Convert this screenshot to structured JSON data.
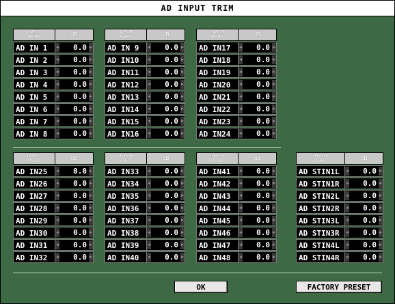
{
  "window": {
    "title": "AD INPUT TRIM"
  },
  "columns": {
    "port": "INPUT\nPORT",
    "db": "dB"
  },
  "groups": [
    {
      "id": "in-1-8",
      "rows": [
        [
          "AD IN 1",
          "0.0"
        ],
        [
          "AD IN 2",
          "0.0"
        ],
        [
          "AD IN 3",
          "0.0"
        ],
        [
          "AD IN 4",
          "0.0"
        ],
        [
          "AD IN 5",
          "0.0"
        ],
        [
          "AD IN 6",
          "0.0"
        ],
        [
          "AD IN 7",
          "0.0"
        ],
        [
          "AD IN 8",
          "0.0"
        ]
      ]
    },
    {
      "id": "in-9-16",
      "rows": [
        [
          "AD IN 9",
          "0.0"
        ],
        [
          "AD IN10",
          "0.0"
        ],
        [
          "AD IN11",
          "0.0"
        ],
        [
          "AD IN12",
          "0.0"
        ],
        [
          "AD IN13",
          "0.0"
        ],
        [
          "AD IN14",
          "0.0"
        ],
        [
          "AD IN15",
          "0.0"
        ],
        [
          "AD IN16",
          "0.0"
        ]
      ]
    },
    {
      "id": "in-17-24",
      "rows": [
        [
          "AD IN17",
          "0.0"
        ],
        [
          "AD IN18",
          "0.0"
        ],
        [
          "AD IN19",
          "0.0"
        ],
        [
          "AD IN20",
          "0.0"
        ],
        [
          "AD IN21",
          "0.0"
        ],
        [
          "AD IN22",
          "0.0"
        ],
        [
          "AD IN23",
          "0.0"
        ],
        [
          "AD IN24",
          "0.0"
        ]
      ]
    },
    {
      "id": "in-25-32",
      "rows": [
        [
          "AD IN25",
          "0.0"
        ],
        [
          "AD IN26",
          "0.0"
        ],
        [
          "AD IN27",
          "0.0"
        ],
        [
          "AD IN28",
          "0.0"
        ],
        [
          "AD IN29",
          "0.0"
        ],
        [
          "AD IN30",
          "0.0"
        ],
        [
          "AD IN31",
          "0.0"
        ],
        [
          "AD IN32",
          "0.0"
        ]
      ]
    },
    {
      "id": "in-33-40",
      "rows": [
        [
          "AD IN33",
          "0.0"
        ],
        [
          "AD IN34",
          "0.0"
        ],
        [
          "AD IN35",
          "0.0"
        ],
        [
          "AD IN36",
          "0.0"
        ],
        [
          "AD IN37",
          "0.0"
        ],
        [
          "AD IN38",
          "0.0"
        ],
        [
          "AD IN39",
          "0.0"
        ],
        [
          "AD IN40",
          "0.0"
        ]
      ]
    },
    {
      "id": "in-41-48",
      "rows": [
        [
          "AD IN41",
          "0.0"
        ],
        [
          "AD IN42",
          "0.0"
        ],
        [
          "AD IN43",
          "0.0"
        ],
        [
          "AD IN44",
          "0.0"
        ],
        [
          "AD IN45",
          "0.0"
        ],
        [
          "AD IN46",
          "0.0"
        ],
        [
          "AD IN47",
          "0.0"
        ],
        [
          "AD IN48",
          "0.0"
        ]
      ]
    },
    {
      "id": "stin",
      "rows": [
        [
          "AD STIN1L",
          "0.0"
        ],
        [
          "AD STIN1R",
          "0.0"
        ],
        [
          "AD STIN2L",
          "0.0"
        ],
        [
          "AD STIN2R",
          "0.0"
        ],
        [
          "AD STIN3L",
          "0.0"
        ],
        [
          "AD STIN3R",
          "0.0"
        ],
        [
          "AD STIN4L",
          "0.0"
        ],
        [
          "AD STIN4R",
          "0.0"
        ]
      ]
    }
  ],
  "buttons": {
    "ok": "OK",
    "factory_preset": "FACTORY PRESET"
  },
  "icons": {
    "decrement": "left-arrow-icon",
    "increment": "right-arrow-icon"
  },
  "colors": {
    "background": "#3d6a44",
    "cell": "#000000",
    "header": "#c8c8c8"
  }
}
